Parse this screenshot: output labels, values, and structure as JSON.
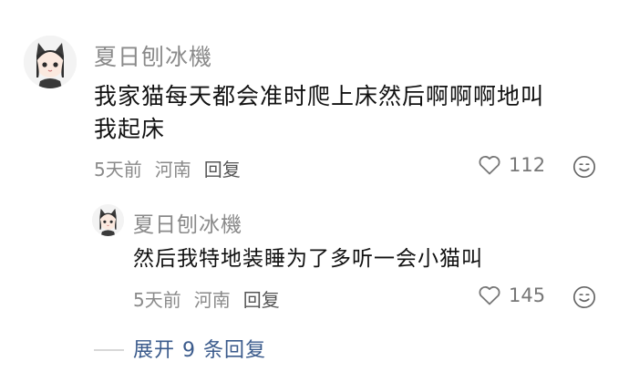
{
  "comment": {
    "username": "夏日刨冰機",
    "text_line1": "我家猫每天都会准时爬上床然后啊啊啊地叫",
    "text_line2": "我起床",
    "time": "5天前",
    "location": "河南",
    "reply_label": "回复",
    "likes": "112"
  },
  "reply": {
    "username": "夏日刨冰機",
    "text": "然后我特地装睡为了多听一会小猫叫",
    "time": "5天前",
    "location": "河南",
    "reply_label": "回复",
    "likes": "145"
  },
  "expand": {
    "label": "展开 9 条回复"
  },
  "icons": {
    "like": "heart-icon",
    "emoji": "emoji-face-icon"
  },
  "colors": {
    "username": "#8a8a8a",
    "text": "#111111",
    "link": "#3b5b8c"
  }
}
